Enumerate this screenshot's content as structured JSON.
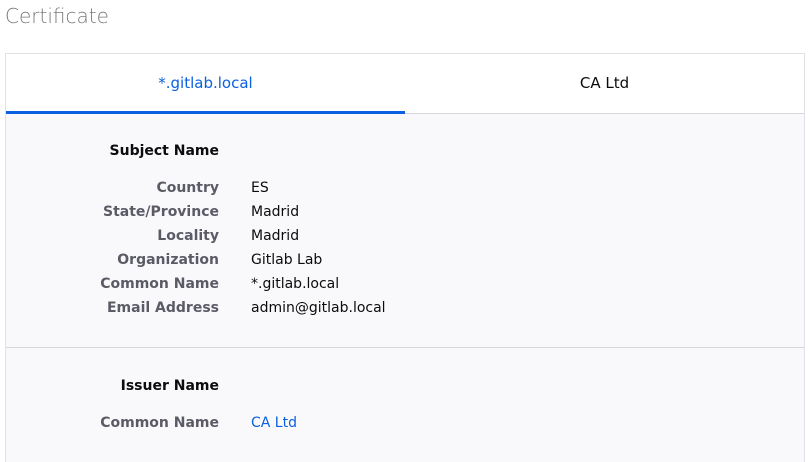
{
  "page": {
    "title": "Certificate"
  },
  "tabs": [
    {
      "label": "*.gitlab.local",
      "selected": true
    },
    {
      "label": "CA Ltd",
      "selected": false
    }
  ],
  "subject": {
    "heading": "Subject Name",
    "rows": [
      {
        "label": "Country",
        "value": "ES"
      },
      {
        "label": "State/Province",
        "value": "Madrid"
      },
      {
        "label": "Locality",
        "value": "Madrid"
      },
      {
        "label": "Organization",
        "value": "Gitlab Lab"
      },
      {
        "label": "Common Name",
        "value": "*.gitlab.local"
      },
      {
        "label": "Email Address",
        "value": "admin@gitlab.local"
      }
    ]
  },
  "issuer": {
    "heading": "Issuer Name",
    "rows": [
      {
        "label": "Common Name",
        "value": "CA Ltd"
      }
    ]
  },
  "colors": {
    "accent": "#0a60e0",
    "label": "#5b5b66",
    "text": "#0c0c0d",
    "title": "#7a7a7a"
  }
}
